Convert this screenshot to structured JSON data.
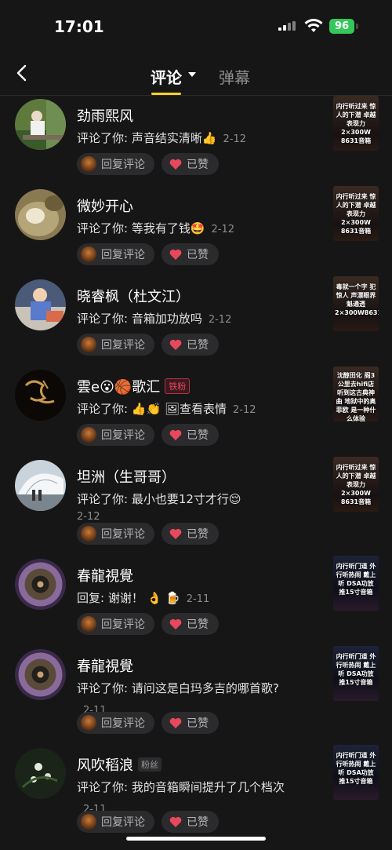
{
  "status_bar": {
    "time": "17:01",
    "battery": "96"
  },
  "header": {
    "tab_comment": "评论",
    "tab_danmu": "弹幕"
  },
  "labels": {
    "reply": "回复评论",
    "liked": "已赞"
  },
  "colors": {
    "accent": "#fdd22c",
    "like": "#e8485c",
    "battery": "#34c759"
  },
  "comments": [
    {
      "name": "劲雨熙风",
      "badge": "",
      "prefix": "评论了你: ",
      "text": "声音结实清晰",
      "emoji": "👍",
      "date": "2-12",
      "thumb": "内行听过来 惊人的下潜 卓越表现力 2×300W 8631音箱"
    },
    {
      "name": "微妙开心",
      "badge": "",
      "prefix": "评论了你: ",
      "text": "等我有了钱",
      "emoji": "🤩",
      "date": "2-12",
      "thumb": "内行听过来 惊人的下潜 卓越表现力 2×300W 8631音箱"
    },
    {
      "name": "晓睿枫（杜文江）",
      "badge": "",
      "prefix": "评论了你: ",
      "text": "音箱加功放吗",
      "emoji": "",
      "date": "2-12",
      "thumb": "毒就一个字 犯惊人 声漂眼界 魁通透 2×300W8631"
    },
    {
      "name": "雲e😮🏀歌汇",
      "badge": "铁粉",
      "prefix": "评论了你: ",
      "text": "👍👏  🖼查看表情",
      "emoji": "",
      "date": "2-12",
      "thumb": "沈醇田化 阁3公里去hifi店 听到这古典神曲 地狱中的奥菲欧 是一种什么体验"
    },
    {
      "name": "坦洲（生哥哥）",
      "badge": "",
      "prefix": "评论了你: ",
      "text": "最小也要12寸才行",
      "emoji": "😌",
      "date": "2-12",
      "thumb": "内行听过来 惊人的下潜 卓越表现力 2×300W 8631音箱"
    },
    {
      "name": "春龍視覺",
      "badge": "",
      "prefix": "回复: ",
      "text": "谢谢！",
      "emoji": "👌 🍺",
      "date": "2-11",
      "thumb": "内行听门道 外行听热闹 戴上听 DSA功放 推15寸音箱"
    },
    {
      "name": "春龍視覺",
      "badge": "",
      "prefix": "评论了你: ",
      "text": "请问这是白玛多吉的哪首歌?",
      "emoji": "",
      "date": "2-11",
      "thumb": "内行听门道 外行听热闹 戴上听 DSA功放 推15寸音箱"
    },
    {
      "name": "风吹稻浪",
      "badge": "粉丝",
      "prefix": "评论了你: ",
      "text": "我的音箱瞬间提升了几个档次",
      "emoji": "",
      "date": "2-11",
      "thumb": "内行听门道 外行听热闹 戴上听 DSA功放 推15寸音箱"
    }
  ]
}
